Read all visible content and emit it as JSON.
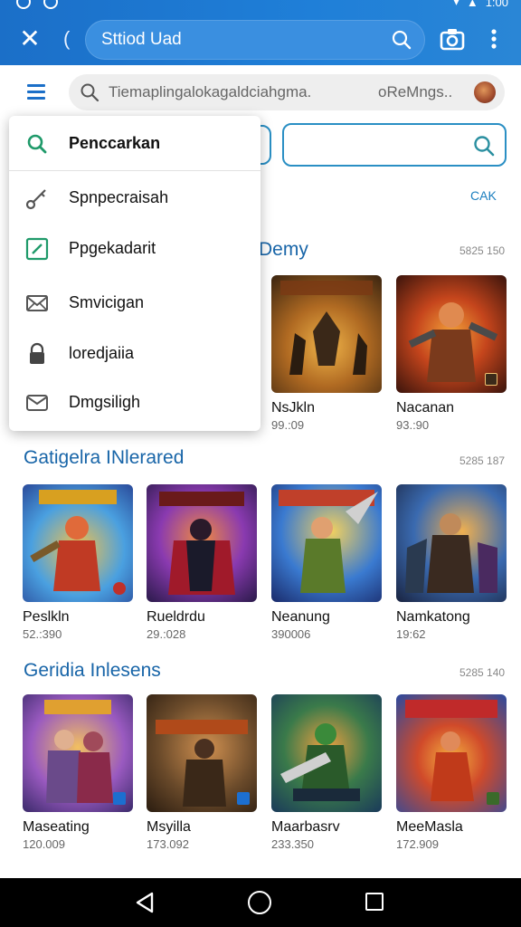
{
  "status": {
    "time": "1:00"
  },
  "appbar": {
    "paren": "(",
    "search_text": "Sttiod Uad"
  },
  "toolbar": {
    "search_placeholder": "Tiemaplingalokagaldciahgma.",
    "search_right": "oReMngs.."
  },
  "filters": {
    "link": "CAK"
  },
  "dropdown": {
    "items": [
      {
        "label": "Penccarkan",
        "icon": "search-icon"
      },
      {
        "label": "Spnpecraisah",
        "icon": "key-icon"
      },
      {
        "label": "Ppgekadarit",
        "icon": "edit-square-icon"
      },
      {
        "label": "Smvicigan",
        "icon": "mail-icon"
      },
      {
        "label": "loredjaiia",
        "icon": "lock-icon"
      },
      {
        "label": "Dmgsiligh",
        "icon": "mail-icon"
      }
    ]
  },
  "sections": [
    {
      "title_fragment": "Demy",
      "count": "5825 150",
      "cards": [
        {
          "name": "NsJkln",
          "sub": "99.:09"
        },
        {
          "name": "Nacanan",
          "sub": "93.:90"
        }
      ]
    },
    {
      "title": "Gatigelra INlerared",
      "count": "5285 187",
      "cards": [
        {
          "name": "Peslkln",
          "sub": "52.:390"
        },
        {
          "name": "Rueldrdu",
          "sub": "29.:028"
        },
        {
          "name": "Neanung",
          "sub": "390006"
        },
        {
          "name": "Namkatong",
          "sub": "19:62"
        }
      ]
    },
    {
      "title": "Geridia Inlesens",
      "count": "5285 140",
      "cards": [
        {
          "name": "Maseating",
          "sub": "120.009"
        },
        {
          "name": "Msyilla",
          "sub": "173.092"
        },
        {
          "name": "Maarbasrv",
          "sub": "233.350"
        },
        {
          "name": "MeeMasla",
          "sub": "172.909"
        }
      ]
    }
  ],
  "colors": {
    "appbar": "#1b6fc8",
    "accent": "#1865a8",
    "outline": "#2a8fc4"
  }
}
